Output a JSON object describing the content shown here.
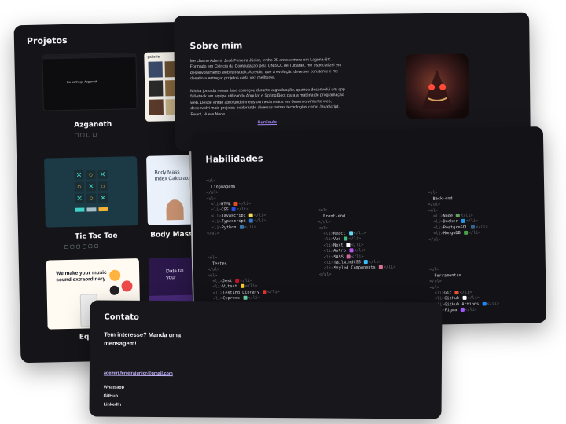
{
  "projetos": {
    "title": "Projetos",
    "items": [
      {
        "name": "Azganoth",
        "thumb_text": "Eu conheço Azganoth"
      },
      {
        "name": "Gallerie",
        "thumb_text": "gallerie"
      },
      {
        "name": "Tic Tac Toe"
      },
      {
        "name": "Body Mass Inc",
        "thumb_text": "Body Mass Index Calculator"
      },
      {
        "name": "Equ",
        "thumb_text": "We make your music sound extraordinary."
      },
      {
        "name": "",
        "thumb_text": "Data tal your"
      }
    ]
  },
  "sobre": {
    "title": "Sobre mim",
    "p1": "Me chamo Ademir José Ferreira Júnior, tenho 25 anos e moro em Laguna-SC. Formado em Ciência da Computação pela UNISUL de Tubarão, me especializei em desenvolvimento web full-stack. Acredito que a evolução deve ser constante e me desafio a entregar projetos cada vez melhores.",
    "p2": "Minha jornada nessa área começou durante a graduação, quando desenvolvi um app full-stack em equipe utilizando Angular e Spring Boot para a matéria de programação web. Desde então aprofundei meus conhecimentos em desenvolvimento web, desenvolvi mais projetos explorando diversas outras tecnologias como JavaScript, React, Vue e Node.",
    "link": "Currículo"
  },
  "habilidades": {
    "title": "Habilidades",
    "linguagens": {
      "label": "Linguagens",
      "items": [
        "HTML",
        "CSS",
        "Javascript",
        "Typescript",
        "Python"
      ]
    },
    "frontend": {
      "label": "Front-end",
      "items": [
        "React",
        "Vue",
        "Next",
        "Astro",
        "SASS",
        "TailwindCSS",
        "Styled Components"
      ]
    },
    "backend": {
      "label": "Back-end",
      "items": [
        "Node",
        "Docker",
        "PostgreSQL",
        "MongoDB"
      ]
    },
    "testes": {
      "label": "Testes",
      "items": [
        "Jest",
        "Vitest",
        "Testing Library",
        "Cypress"
      ]
    },
    "ferramentas": {
      "label": "Ferramentas",
      "items": [
        "Git",
        "GitHub",
        "GitHub Actions",
        "Figma"
      ]
    },
    "ul_open": "<ul>",
    "ul_close": "</ul>",
    "li_open": "<li>",
    "li_close": "</li>"
  },
  "contato": {
    "title": "Contato",
    "subtitle": "Tem interesse? Manda uma mensagem!",
    "email": "ademirj.ferreirajunior@gmail.com",
    "links": [
      "Whatsapp",
      "GitHub",
      "LinkedIn"
    ]
  },
  "colors": {
    "accent": "#a78bfa",
    "panel": "#151519"
  }
}
